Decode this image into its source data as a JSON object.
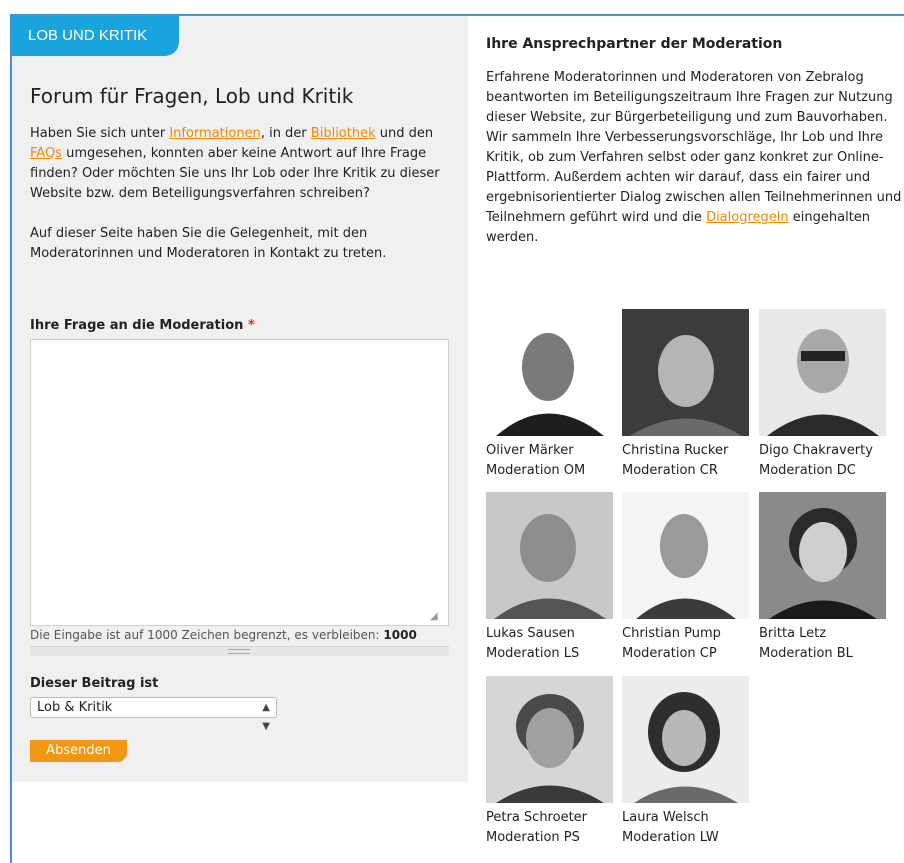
{
  "left": {
    "tab_label": "LOB UND KRITIK",
    "title": "Forum für Fragen, Lob und Kritik",
    "intro": {
      "part1": "Haben Sie sich unter ",
      "link1": "Informationen",
      "part2": ", in der ",
      "link2": "Bibliothek",
      "part3": " und den ",
      "link3": "FAQs",
      "part4": " umgesehen, konnten aber keine Antwort auf Ihre Frage finden? Oder möchten Sie uns Ihr Lob oder Ihre Kritik zu dieser Website bzw. dem Beteiligungsverfahren schreiben?"
    },
    "intro2": "Auf dieser Seite haben Sie die Gelegenheit, mit den Moderatorinnen und Moderatoren in Kontakt zu treten.",
    "question_label": "Ihre Frage an die Moderation",
    "required_marker": "*",
    "question_value": "",
    "counter_text": "Die Eingabe ist auf 1000 Zeichen begrenzt, es verbleiben:",
    "counter_value": "1000",
    "type_label": "Dieser Beitrag ist",
    "type_selected": "Lob & Kritik",
    "submit_label": "Absenden"
  },
  "right": {
    "heading": "Ihre Ansprechpartner der Moderation",
    "text_part1": "Erfahrene Moderatorinnen und Moderatoren von Zebralog beantworten im Beteiligungszeitraum Ihre Fragen zur Nutzung dieser Website, zur Bürgerbeteiligung und zum Bauvorhaben. Wir sammeln Ihre Verbesserungsvorschläge, Ihr Lob und Ihre Kritik, ob zum Verfahren selbst oder ganz konkret zur Online-Plattform. Außerdem achten wir darauf, dass ein fairer und ergebnisorientierter Dialog zwischen allen Teilnehmerinnen und Teilnehmern geführt wird und die ",
    "text_link": "Dialogregeln",
    "text_part2": " eingehalten werden."
  },
  "moderators": [
    {
      "name": "Oliver Märker",
      "role": "Moderation OM"
    },
    {
      "name": "Christina Rucker",
      "role": "Moderation CR"
    },
    {
      "name": "Digo Chakraverty",
      "role": "Moderation DC"
    },
    {
      "name": "Lukas Sausen",
      "role": "Moderation LS"
    },
    {
      "name": "Christian Pump",
      "role": "Moderation CP"
    },
    {
      "name": "Britta Letz",
      "role": "Moderation BL"
    },
    {
      "name": "Petra Schroeter",
      "role": "Moderation PS"
    },
    {
      "name": "Laura Welsch",
      "role": "Moderation LW"
    }
  ]
}
